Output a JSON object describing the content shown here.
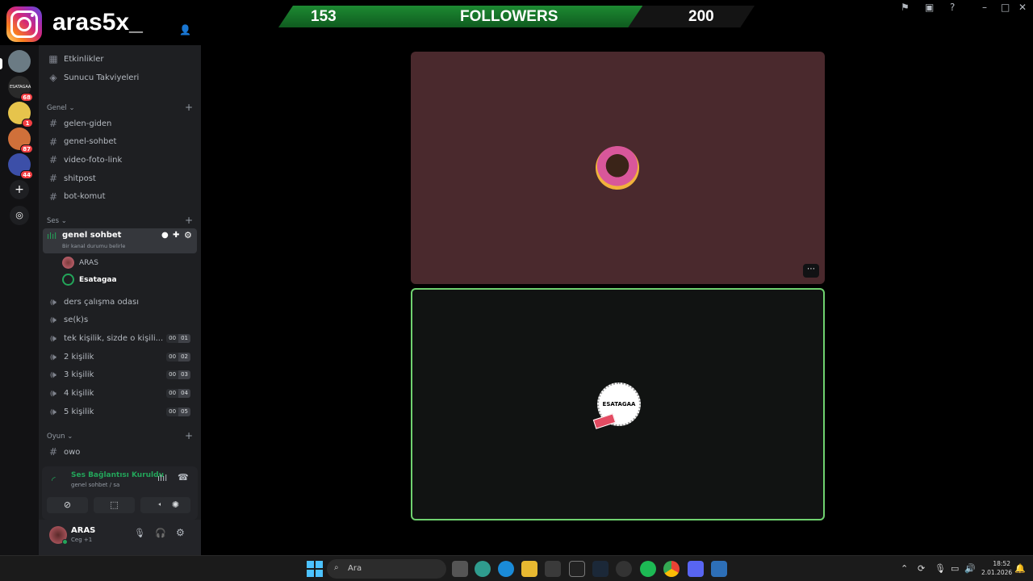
{
  "overlay": {
    "instagram_handle": "aras5x_",
    "followers": {
      "current": "153",
      "label": "FOLLOWERS",
      "goal": "200",
      "progress": 0.765
    }
  },
  "servers": [
    {
      "name": "server-1",
      "badge": "",
      "color": "#6b7b84"
    },
    {
      "name": "ESATAGAA",
      "badge": "68",
      "color": "#2a2a2a"
    },
    {
      "name": "server-3",
      "badge": "1",
      "color": "#e6c44c"
    },
    {
      "name": "server-4",
      "badge": "87",
      "color": "#d0703a"
    },
    {
      "name": "server-5",
      "badge": "44",
      "color": "#3c4fa8"
    }
  ],
  "sidebar": {
    "top_items": [
      {
        "label": "Etkinlikler"
      },
      {
        "label": "Sunucu Takviyeleri"
      }
    ],
    "categories": {
      "general": "Genel",
      "voice": "Ses",
      "game": "Oyun"
    },
    "text_channels": [
      "gelen-giden",
      "genel-sohbet",
      "video-foto-link",
      "shitpost",
      "bot-komut"
    ],
    "active_voice": {
      "name": "genel sohbet",
      "status": "Bir kanal durumu belirle"
    },
    "voice_users": [
      {
        "name": "ARAS"
      },
      {
        "name": "Esatagaa"
      }
    ],
    "voice_channels": [
      {
        "name": "ders çalışma odası",
        "count": "",
        "limit": ""
      },
      {
        "name": "se(k)s",
        "count": "",
        "limit": ""
      },
      {
        "name": "tek kişilik, sizde o kişili...",
        "count": "00",
        "limit": "01"
      },
      {
        "name": "2 kişilik",
        "count": "00",
        "limit": "02"
      },
      {
        "name": "3 kişilik",
        "count": "00",
        "limit": "03"
      },
      {
        "name": "4 kişilik",
        "count": "00",
        "limit": "04"
      },
      {
        "name": "5 kişilik",
        "count": "00",
        "limit": "05"
      }
    ],
    "game_channels": [
      "owo"
    ]
  },
  "voice_panel": {
    "status": "Ses Bağlantısı Kuruldu",
    "channel": "genel sohbet / sa"
  },
  "user_panel": {
    "username": "ARAS",
    "activity": "Ceg +1"
  },
  "stage": {
    "tile_bottom_label": "ESATAGAA"
  },
  "taskbar": {
    "search_placeholder": "Ara",
    "time": "18:52",
    "date": "2.01.2026"
  },
  "colors": {
    "accent_green": "#23a55a",
    "tile_top": "#4a292d",
    "speaking_border": "#6fd16f"
  }
}
